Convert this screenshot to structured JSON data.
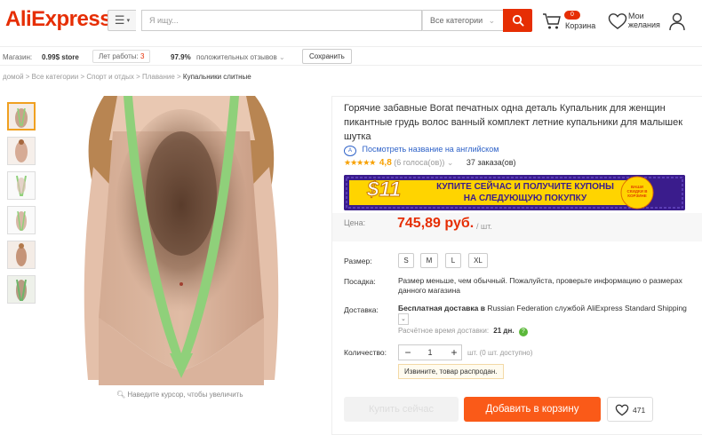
{
  "header": {
    "logo": "AliExpress",
    "search_placeholder": "Я ищу...",
    "category_select": "Все категории",
    "cart_count": "0",
    "cart_label": "Корзина",
    "wishlist_label": "Мои желания"
  },
  "store_bar": {
    "store_prefix": "Магазин:",
    "store_name": "0.99$ store",
    "years_label": "Лет работы:",
    "years_value": "3",
    "positive_percent": "97.9%",
    "positive_label": "положительных отзывов",
    "save_button": "Сохранить"
  },
  "breadcrumb": [
    "домой",
    "Все категории",
    "Спорт и отдых",
    "Плавание",
    "Купальники слитные"
  ],
  "gallery": {
    "thumb_count": 6,
    "zoom_hint": "Наведите курсор, чтобы увеличить"
  },
  "product": {
    "title": "Горячие забавные Borat печатных одна деталь Купальник для женщин пикантные грудь волос ванный комплект летние купальники для малышек шутка",
    "translate_link": "Посмотреть название на английском",
    "rating": "4,8",
    "rating_stars": 5,
    "votes": "(6 голоса(ов))",
    "orders": "37 заказа(ов)",
    "promo": {
      "amount": "$11",
      "text_line1": "КУПИТЕ СЕЙЧАС И ПОЛУЧИТЕ КУПОНЫ",
      "text_line2": "НА СЛЕДУЮЩУЮ ПОКУПКУ",
      "badge": "ВАШИ СКИДКИ В КОРЗИНЕ"
    },
    "price_label": "Цена:",
    "price": "745,89 руб.",
    "price_unit": "/ шт.",
    "size_label": "Размер:",
    "sizes": [
      "S",
      "M",
      "L",
      "XL"
    ],
    "fit_label": "Посадка:",
    "fit_text": "Размер меньше, чем обычный. Пожалуйста, проверьте информацию о размерах данного магазина",
    "delivery_label": "Доставка:",
    "delivery_bold": "Бесплатная доставка в",
    "delivery_rest": "Russian Federation службой AliExpress Standard Shipping",
    "delivery_time_label": "Расчётное время доставки:",
    "delivery_time_value": "21 дн.",
    "quantity_label": "Количество:",
    "quantity_value": "1",
    "quantity_note": "шт. (0 шт. доступно)",
    "sold_out": "Извините, товар распродан.",
    "buy_now": "Купить сейчас",
    "add_to_cart": "Добавить в корзину",
    "wish_count": "471"
  },
  "colors": {
    "brand": "#e62e04",
    "add_to_cart": "#fa5a18",
    "promo_bg": "#3a1c8c",
    "promo_yellow": "#ffd400",
    "link": "#2e62c8",
    "star": "#f7a000"
  }
}
